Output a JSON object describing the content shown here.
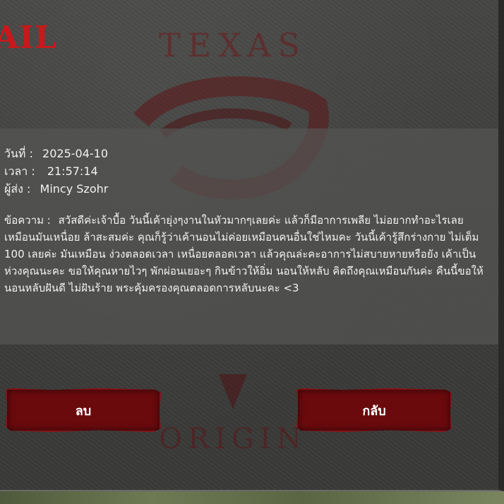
{
  "header": {
    "title": "AIL"
  },
  "background": {
    "emblem_top": "TEXAS",
    "emblem_bottom": "ORIGIN"
  },
  "mail": {
    "date_label": "วันที่ :",
    "date_value": "2025-04-10",
    "time_label": "เวลา :",
    "time_value": "21:57:14",
    "sender_label": "ผู้ส่ง :",
    "sender_value": "Mincy Szohr",
    "message_label": "ข้อความ :",
    "message_text": "สวัสดีค่ะเจ้าบื้อ วันนี้เค้ายุ่งๆงานในหัวมากๆเลยค่ะ แล้วก็มีอาการเพลีย ไม่อยากทำอะไรเลย เหมือนมันเหนื่อย ล้าสะสมค่ะ คุณก็รู้ว่าเค้านอนไม่ค่อยเหมือนคนอื่นใช่ไหมคะ วันนี้เค้ารู้สึกร่างกาย ไม่เต็ม 100 เลยค่ะ มันเหมือน ง่วงตลอดเวลา เหนื่อยตลอดเวลา แล้วคุณล่ะคะอาการไม่สบายหายหรือยัง เค้าเป็นห่วงคุณนะคะ ขอให้คุณหายไวๆ พักผ่อนเยอะๆ กินข้าวให้อิ่ม นอนให้หลับ คิดถึงคุณเหมือนกันค่ะ คืนนี้ขอให้นอนหลับฝันดี ไม่ฝันร้าย พระคุ้มครองคุณตลอดการหลับนะคะ <3"
  },
  "buttons": {
    "delete_label": "ลบ",
    "back_label": "กลับ"
  },
  "colors": {
    "title": "#c8181c",
    "button": "#6a0a0d",
    "text": "#f2f2f2"
  }
}
